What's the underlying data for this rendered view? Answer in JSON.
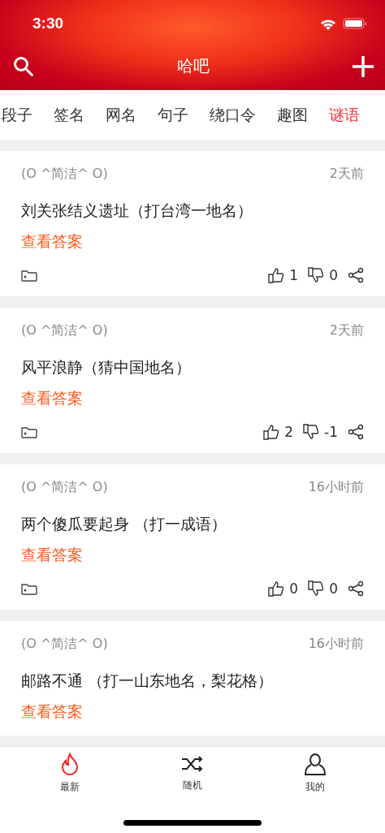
{
  "status_bar": {
    "time": "3:30"
  },
  "nav": {
    "title": "哈吧"
  },
  "categories": [
    {
      "label": "段子",
      "selected": false
    },
    {
      "label": "签名",
      "selected": false
    },
    {
      "label": "网名",
      "selected": false
    },
    {
      "label": "句子",
      "selected": false
    },
    {
      "label": "绕口令",
      "selected": false
    },
    {
      "label": "趣图",
      "selected": false
    },
    {
      "label": "谜语",
      "selected": true
    }
  ],
  "posts": [
    {
      "author": "(O ^简洁^ O)",
      "time": "2天前",
      "text": "刘关张结义遗址（打台湾一地名）",
      "answer_link": "查看答案",
      "likes": "1",
      "dislikes": "0"
    },
    {
      "author": "(O ^简洁^ O)",
      "time": "2天前",
      "text": "风平浪静（猜中国地名）",
      "answer_link": "查看答案",
      "likes": "2",
      "dislikes": "-1"
    },
    {
      "author": "(O ^简洁^ O)",
      "time": "16小时前",
      "text": "两个傻瓜要起身 （打一成语）",
      "answer_link": "查看答案",
      "likes": "0",
      "dislikes": "0"
    },
    {
      "author": "(O ^简洁^ O)",
      "time": "16小时前",
      "text": "邮路不通 （打一山东地名，梨花格）",
      "answer_link": "查看答案"
    }
  ],
  "tab_bar": [
    {
      "kind": "hot",
      "label": "最新",
      "selected": true
    },
    {
      "kind": "shuffle",
      "label": "随机",
      "selected": false
    },
    {
      "kind": "user",
      "label": "我的",
      "selected": false
    }
  ]
}
